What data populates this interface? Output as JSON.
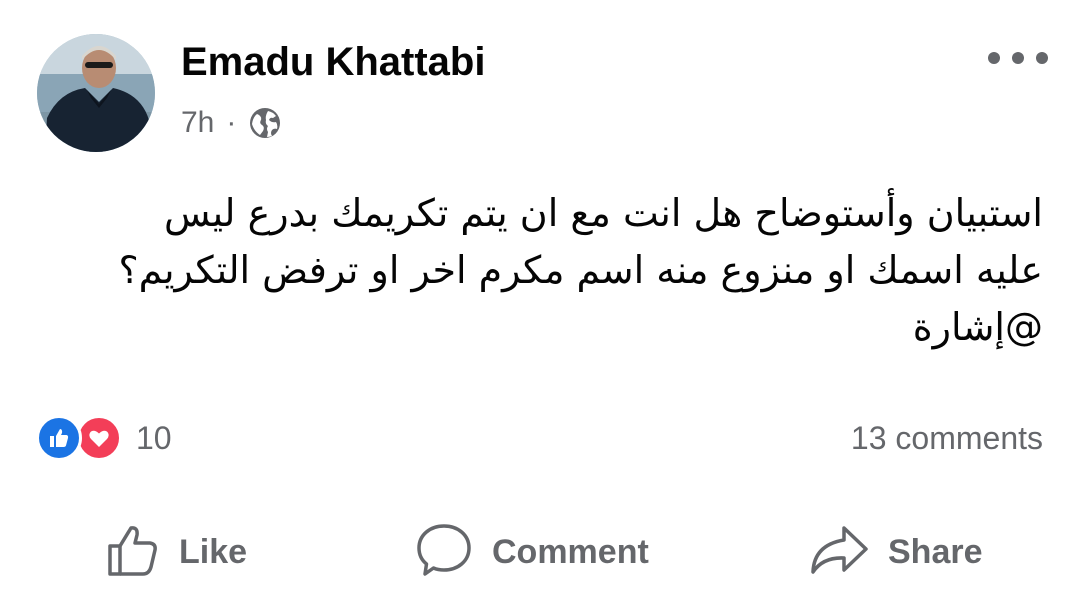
{
  "post": {
    "author": "Emadu Khattabi",
    "time": "7h",
    "separator": "·",
    "privacy_icon": "globe-icon",
    "menu_icon": "more-horizontal-icon",
    "text_lines": [
      "استبيان وأستوضاح هل انت مع ان يتم تكريمك بدرع ليس",
      "عليه اسمك او منزوع منه اسم مكرم اخر او ترفض التكريم؟",
      "@إشارة"
    ],
    "reactions": {
      "icons": [
        "like-icon",
        "love-icon"
      ],
      "count": "10"
    },
    "comments": "13 comments"
  },
  "actions": {
    "like": "Like",
    "comment": "Comment",
    "share": "Share"
  },
  "colors": {
    "text": "#050505",
    "secondary": "#65676b",
    "like_blue": "#1b74e4",
    "love_red": "#f33e58"
  }
}
